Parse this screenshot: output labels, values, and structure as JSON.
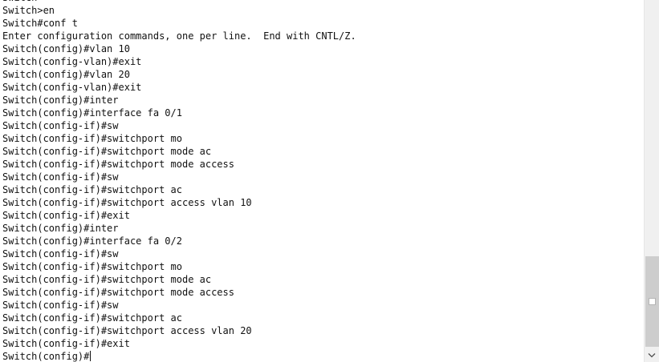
{
  "terminal": {
    "lines": [
      "Switch>",
      "Switch>en",
      "Switch#conf t",
      "Enter configuration commands, one per line.  End with CNTL/Z.",
      "Switch(config)#vlan 10",
      "Switch(config-vlan)#exit",
      "Switch(config)#vlan 20",
      "Switch(config-vlan)#exit",
      "Switch(config)#inter",
      "Switch(config)#interface fa 0/1",
      "Switch(config-if)#sw",
      "Switch(config-if)#switchport mo",
      "Switch(config-if)#switchport mode ac",
      "Switch(config-if)#switchport mode access",
      "Switch(config-if)#sw",
      "Switch(config-if)#switchport ac",
      "Switch(config-if)#switchport access vlan 10",
      "Switch(config-if)#exit",
      "Switch(config)#inter",
      "Switch(config)#interface fa 0/2",
      "Switch(config-if)#sw",
      "Switch(config-if)#switchport mo",
      "Switch(config-if)#switchport mode ac",
      "Switch(config-if)#switchport mode access",
      "Switch(config-if)#sw",
      "Switch(config-if)#switchport ac",
      "Switch(config-if)#switchport access vlan 20",
      "Switch(config-if)#exit",
      "Switch(config)#"
    ]
  },
  "scrollbar": {
    "position": 0.95,
    "down_icon": "chevron-down-icon",
    "grip_icon": "scroll-grip-icon"
  },
  "colors": {
    "text": "#111111",
    "background": "#ffffff",
    "scroll_track": "#f0f0f0",
    "scroll_thumb": "#cdcdcd"
  }
}
